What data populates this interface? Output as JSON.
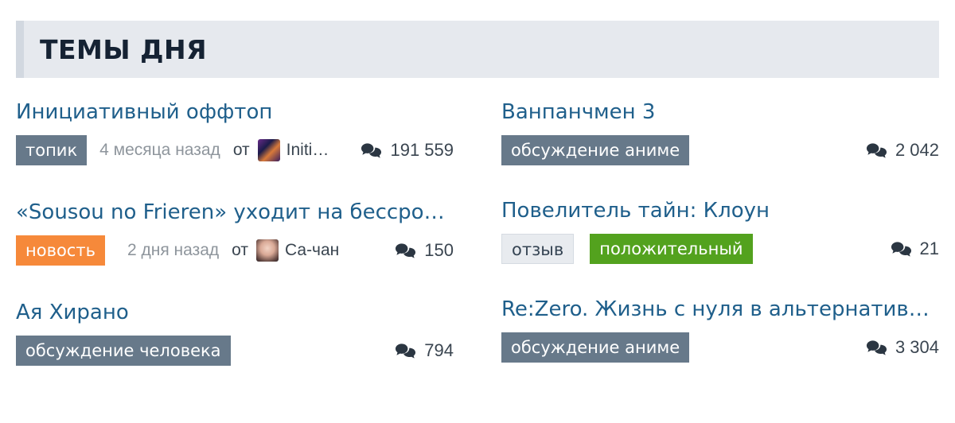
{
  "section": {
    "title": "ТЕМЫ ДНЯ"
  },
  "topics": [
    {
      "title": "Инициативный оффтоп",
      "badges": [
        "топик"
      ],
      "time": "4 месяца назад",
      "from": "от",
      "author": "Initi…",
      "avatar": "author-avatar",
      "comment_icon": "comments-icon",
      "comments": "191 559"
    },
    {
      "title": "Ванпанчмен 3",
      "badges": [
        "обсуждение аниме"
      ],
      "comment_icon": "comments-icon",
      "comments": "2 042"
    },
    {
      "title": "«Sousou no Frieren» уходит на бессро…",
      "badges": [
        "новость"
      ],
      "time": "2 дня назад",
      "from": "от",
      "author": "Са-чан",
      "avatar": "author-avatar",
      "comment_icon": "comments-icon",
      "comments": "150"
    },
    {
      "title": "Повелитель тайн: Клоун",
      "badges": [
        "отзыв",
        "положительный"
      ],
      "comment_icon": "comments-icon",
      "comments": "21"
    },
    {
      "title": "Ая Хирано",
      "badges": [
        "обсуждение человека"
      ],
      "comment_icon": "comments-icon",
      "comments": "794"
    },
    {
      "title": "Re:Zero. Жизнь с нуля в альтернатив…",
      "badges": [
        "обсуждение аниме"
      ],
      "comment_icon": "comments-icon",
      "comments": "3 304"
    }
  ],
  "colors": {
    "link": "#1f5f8b",
    "badge_default": "#67798a",
    "badge_news": "#f6893a",
    "badge_positive": "#53a21e",
    "header_bg": "#e6e9ee"
  }
}
